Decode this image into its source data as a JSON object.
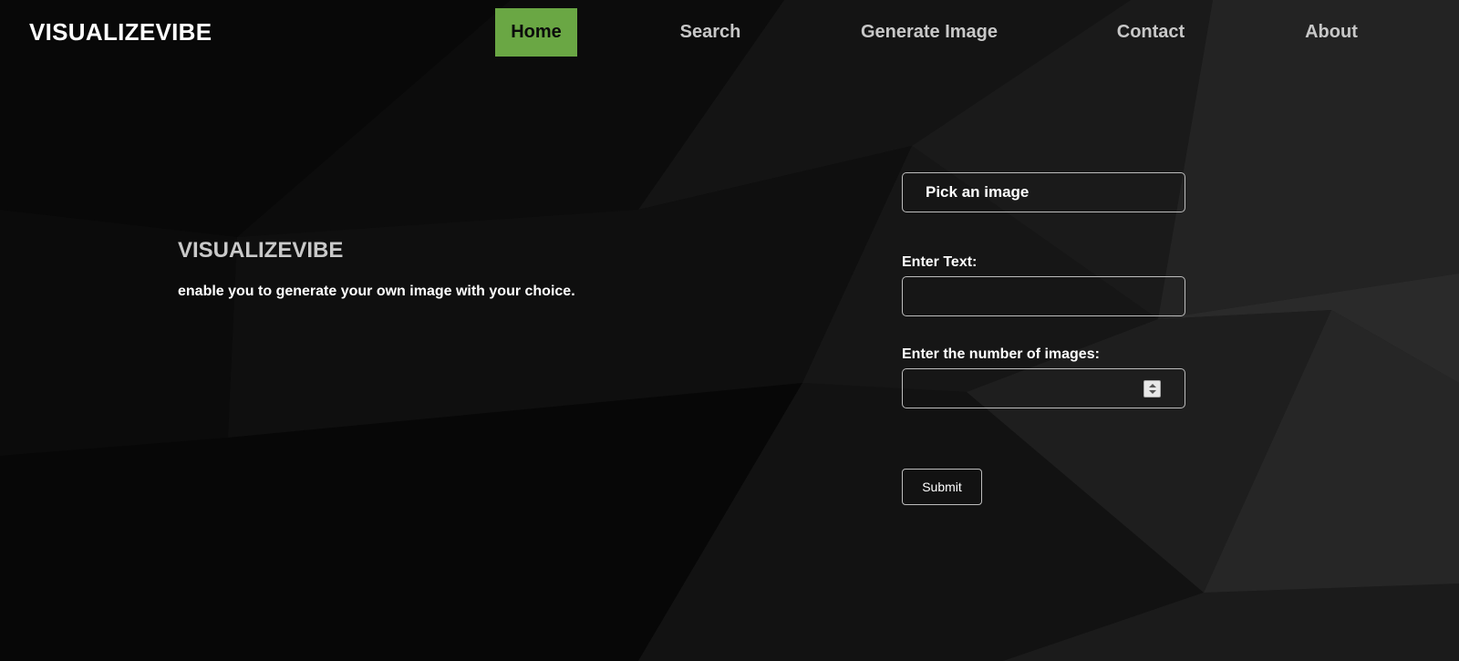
{
  "brand": {
    "logo_text": "VISUALIZEVIBE",
    "accent_color": "#6aa744"
  },
  "nav": {
    "items": [
      {
        "label": "Home",
        "active": true
      },
      {
        "label": "Search",
        "active": false
      },
      {
        "label": "Generate Image",
        "active": false
      },
      {
        "label": "Contact",
        "active": false
      },
      {
        "label": "About",
        "active": false
      }
    ]
  },
  "hero": {
    "title": "VISUALIZEVIBE",
    "subtitle": "enable you to generate your own image with your choice."
  },
  "form": {
    "file_button_label": "Pick an image",
    "text_label": "Enter Text:",
    "text_value": "",
    "number_label": "Enter the number of images:",
    "number_value": "",
    "submit_label": "Submit",
    "stepper_icon": "spin-stepper-icon"
  }
}
